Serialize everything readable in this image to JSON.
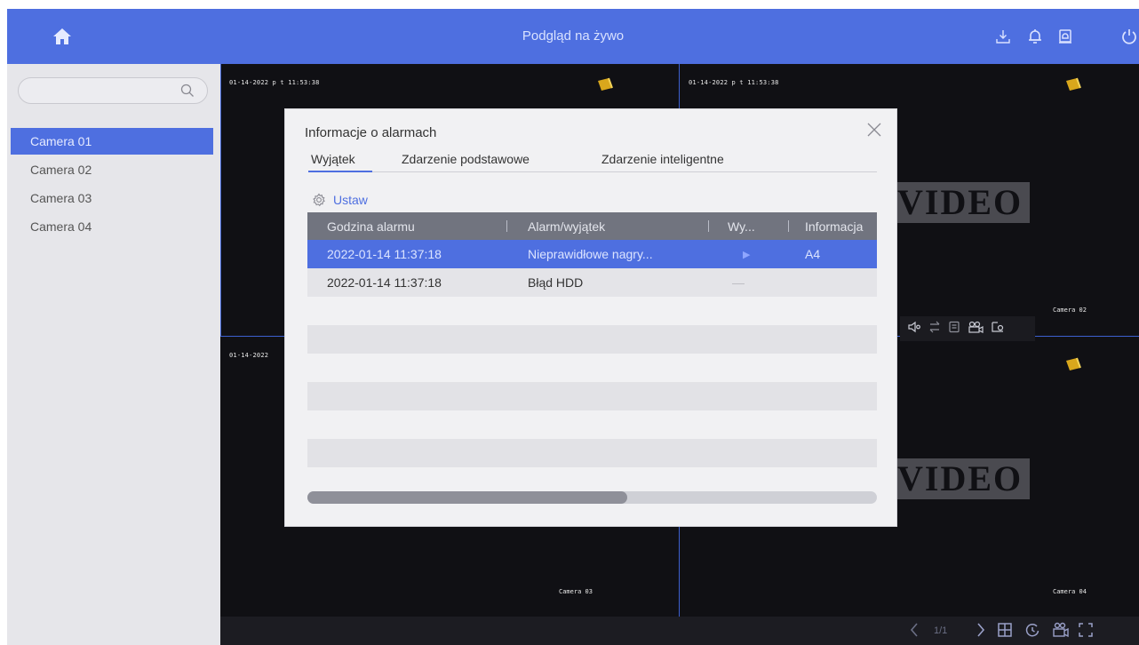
{
  "app": {
    "title": "Podgląd na żywo"
  },
  "sidebar": {
    "search": {
      "value": "",
      "placeholder": ""
    },
    "cameras": [
      "Camera 01",
      "Camera 02",
      "Camera 03",
      "Camera 04"
    ],
    "selected_index": 0
  },
  "grid": {
    "tiles": [
      {
        "timestamp": "01-14-2022 p t 11:53:38",
        "label": "",
        "watermark": ""
      },
      {
        "timestamp": "01-14-2022 p t 11:53:38",
        "label": "Camera 02",
        "watermark": "VIDEO"
      },
      {
        "timestamp": "01-14-2022",
        "label": "Camera 03",
        "watermark": ""
      },
      {
        "timestamp": "",
        "label": "Camera 04",
        "watermark": "VIDEO"
      }
    ]
  },
  "bottombar": {
    "page_indicator": "1/1"
  },
  "dialog": {
    "title": "Informacje o alarmach",
    "tabs": [
      "Wyjątek",
      "Zdarzenie podstawowe",
      "Zdarzenie inteligentne"
    ],
    "active_tab": 0,
    "settings_label": "Ustaw",
    "columns": [
      "Godzina alarmu",
      "Alarm/wyjątek",
      "Wy...",
      "Informacja"
    ],
    "rows": [
      {
        "time": "2022-01-14 11:37:18",
        "event": "Nieprawidłowe nagry...",
        "action": "▶",
        "info": "A4",
        "selected": true
      },
      {
        "time": "2022-01-14 11:37:18",
        "event": "Błąd HDD",
        "action": "—",
        "info": "",
        "selected": false
      }
    ]
  },
  "colors": {
    "accent": "#4e6fe0",
    "sidebar_bg": "#e6e6ea",
    "video_bg": "#101014",
    "dialog_bg": "#f1f1f3",
    "table_header": "#71747f"
  },
  "icons": {
    "home": "home-icon",
    "download": "download-icon",
    "bell": "bell-icon",
    "alarm_box": "alarm-info-icon",
    "power": "power-icon",
    "search": "search-icon",
    "close": "close-icon",
    "settings": "gear-icon"
  }
}
